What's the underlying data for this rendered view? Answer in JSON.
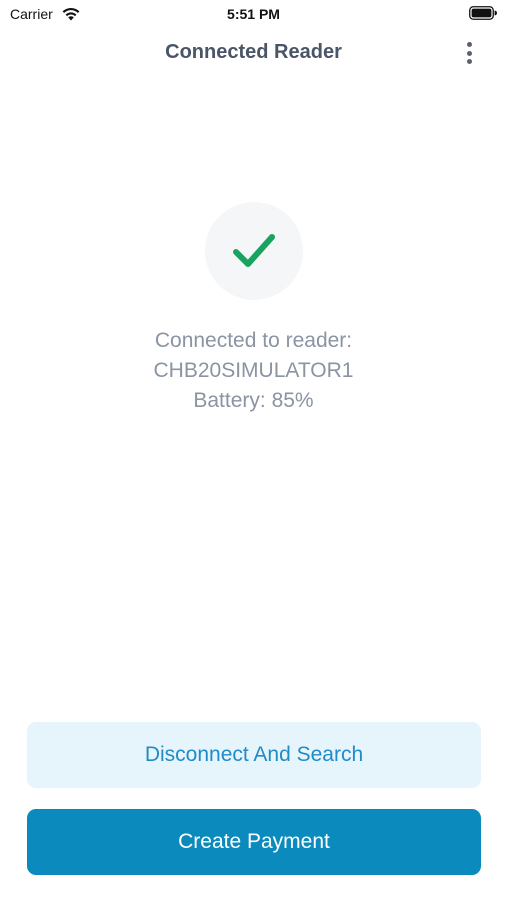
{
  "status_bar": {
    "carrier": "Carrier",
    "time": "5:51 PM",
    "wifi_icon": "wifi-icon",
    "battery_icon": "battery-icon"
  },
  "nav": {
    "title": "Connected Reader",
    "more_icon": "more-vertical-icon"
  },
  "status": {
    "icon": "checkmark-icon",
    "icon_color": "#1aa260",
    "line1": "Connected to reader:",
    "line2": "CHB20SIMULATOR1",
    "line3": "Battery: 85%"
  },
  "actions": {
    "disconnect_label": "Disconnect And Search",
    "create_payment_label": "Create Payment"
  },
  "colors": {
    "title": "#4a5568",
    "secondary_bg": "#e6f4fc",
    "secondary_text": "#1f8cc7",
    "primary_bg": "#0b8bbd",
    "primary_text": "#ffffff"
  }
}
